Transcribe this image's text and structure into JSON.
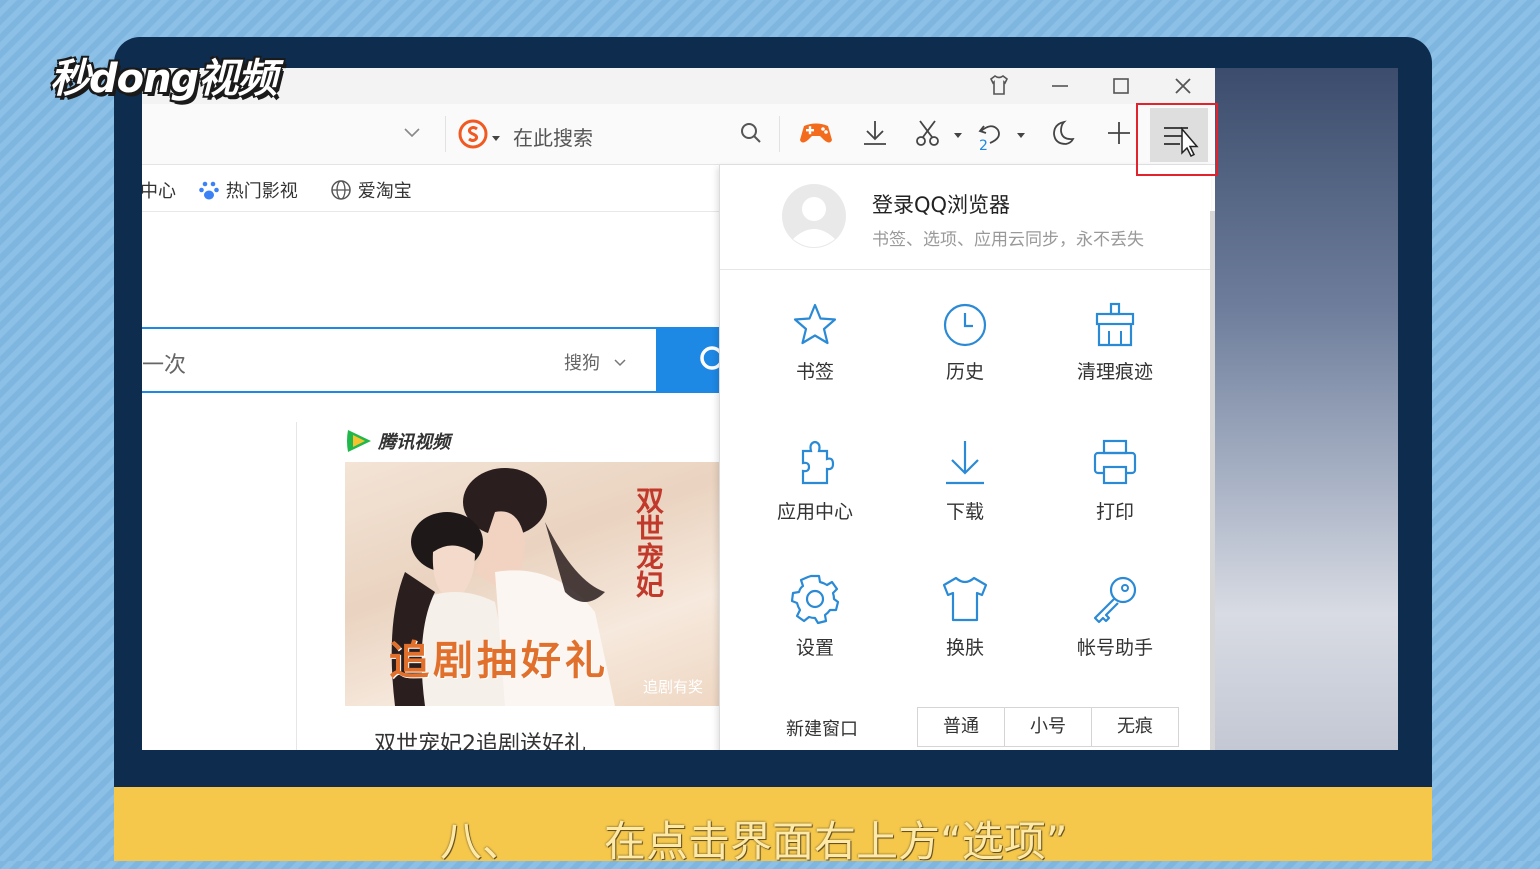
{
  "watermark": {
    "logo_text": "秒dong视频"
  },
  "browser": {
    "search_placeholder": "在此搜索",
    "bookmarks": [
      "中心",
      "热门影视",
      "爱淘宝"
    ],
    "page_search": {
      "text": "一次",
      "engine": "搜狗"
    },
    "redo_count": "2",
    "feed": {
      "brand": "腾讯视频",
      "poster_title": "追剧抽好礼",
      "poster_vertical": "双世宠妃",
      "poster_tag": "追剧有奖",
      "article_title": "双世宠妃2追剧送好礼"
    }
  },
  "menu": {
    "login_title": "登录QQ浏览器",
    "login_subtitle": "书签、选项、应用云同步，永不丢失",
    "items": [
      {
        "label": "书签",
        "icon": "star-icon"
      },
      {
        "label": "历史",
        "icon": "clock-icon"
      },
      {
        "label": "清理痕迹",
        "icon": "broom-icon"
      },
      {
        "label": "应用中心",
        "icon": "puzzle-icon"
      },
      {
        "label": "下载",
        "icon": "download-icon"
      },
      {
        "label": "打印",
        "icon": "printer-icon"
      },
      {
        "label": "设置",
        "icon": "gear-icon"
      },
      {
        "label": "换肤",
        "icon": "shirt-icon"
      },
      {
        "label": "帐号助手",
        "icon": "key-icon"
      }
    ],
    "new_window_label": "新建窗口",
    "window_modes": [
      "普通",
      "小号",
      "无痕"
    ]
  },
  "caption": {
    "step": "八、",
    "instruction": "在点击界面右上方“选项”"
  },
  "colors": {
    "highlight": "#e0232d",
    "accent_blue": "#1e88e5",
    "icon_blue": "#2a8ad6",
    "caption_bar": "#f5c84c"
  }
}
